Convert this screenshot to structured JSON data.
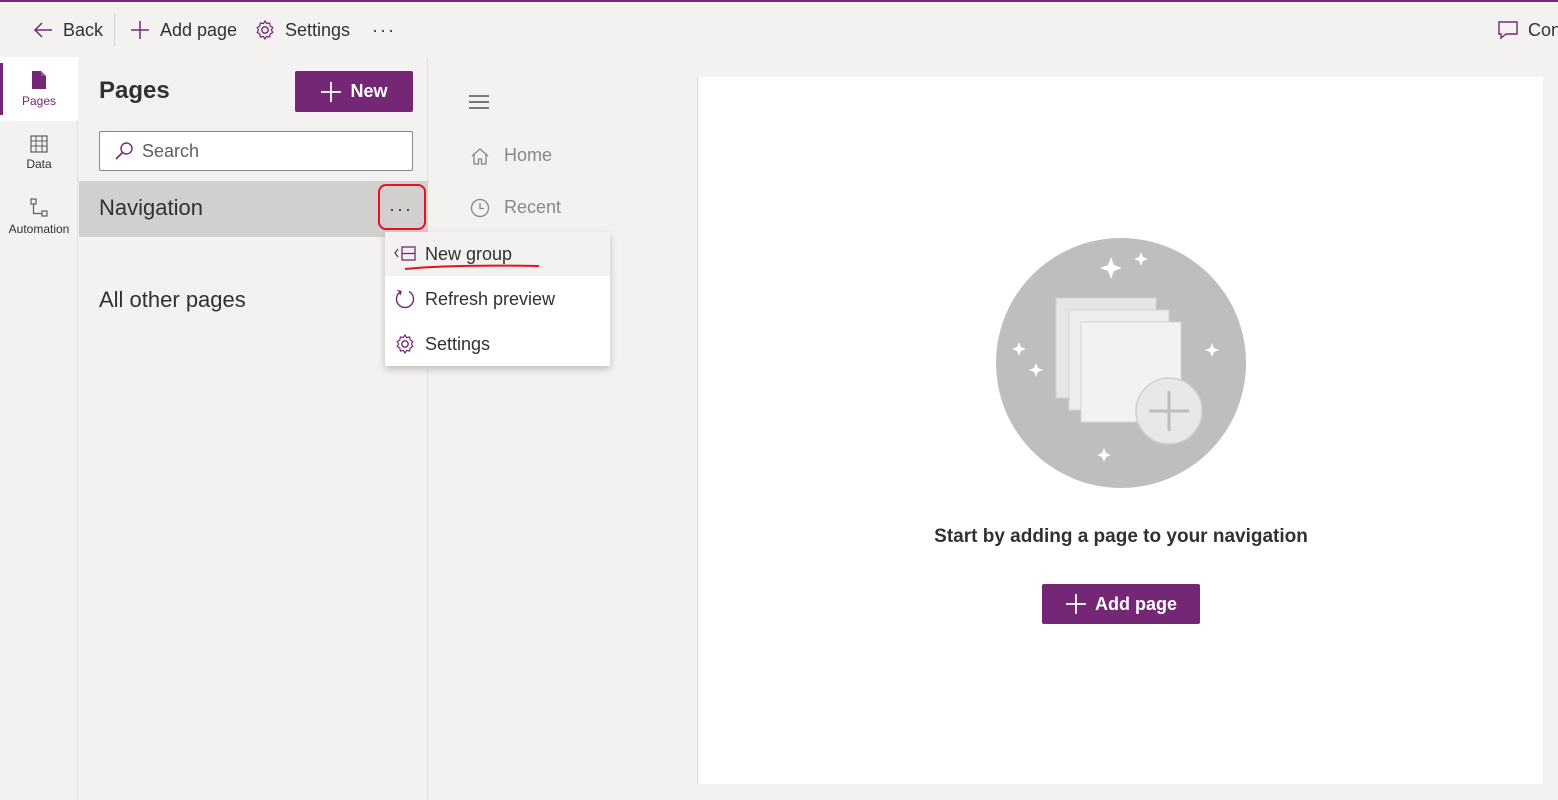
{
  "topbar": {
    "back_label": "Back",
    "add_page_label": "Add page",
    "settings_label": "Settings",
    "more_label": "···",
    "comments_label": "Con"
  },
  "rail": {
    "items": [
      {
        "label": "Pages",
        "icon": "page-icon"
      },
      {
        "label": "Data",
        "icon": "table-icon"
      },
      {
        "label": "Automation",
        "icon": "flow-icon"
      }
    ]
  },
  "pages_panel": {
    "title": "Pages",
    "new_label": "New",
    "search_placeholder": "Search",
    "navigation_label": "Navigation",
    "more_label": "···",
    "all_other_label": "All other pages"
  },
  "context_menu": {
    "items": [
      {
        "label": "New group",
        "icon": "new-group-icon"
      },
      {
        "label": "Refresh preview",
        "icon": "refresh-icon"
      },
      {
        "label": "Settings",
        "icon": "gear-icon"
      }
    ]
  },
  "preview": {
    "nav_items": [
      {
        "label": "Home",
        "icon": "home-icon"
      },
      {
        "label": "Recent",
        "icon": "clock-icon"
      }
    ],
    "empty_message": "Start by adding a page to your navigation",
    "add_page_label": "Add page"
  },
  "colors": {
    "accent": "#742774",
    "annotation": "#e81123"
  }
}
